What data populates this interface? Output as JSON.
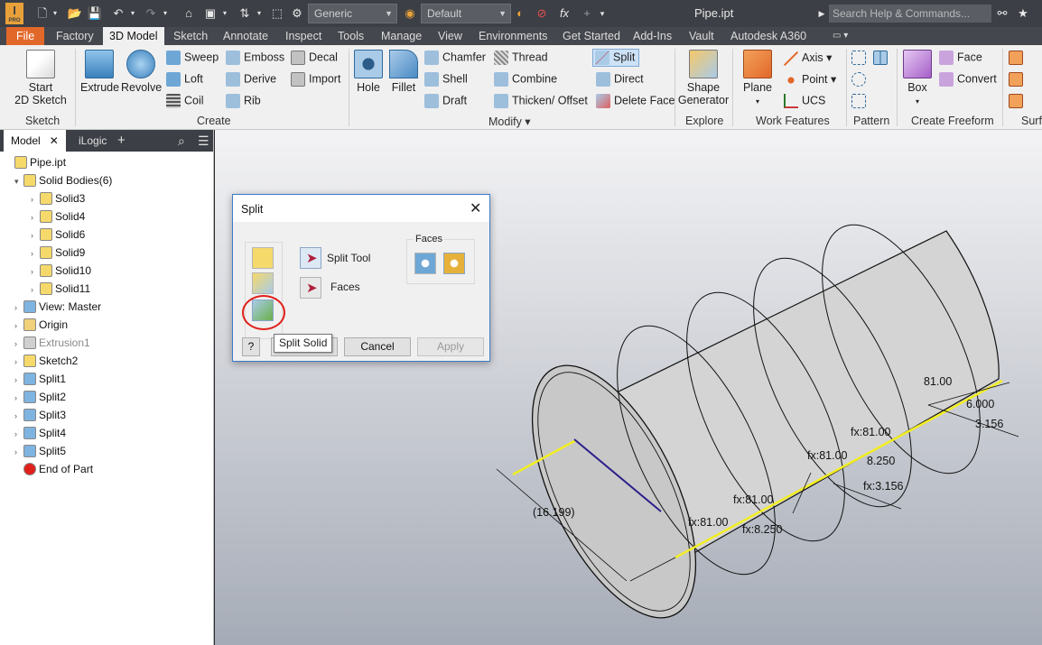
{
  "titlebar": {
    "app_logo": "I",
    "app_logo_sub": "PRO",
    "material_combo": "Generic",
    "appearance_combo": "Default",
    "doc_title": "Pipe.ipt",
    "help_search_placeholder": "Search Help & Commands...",
    "fx_label": "fx"
  },
  "tabs": [
    "File",
    "Factory",
    "3D Model",
    "Sketch",
    "Annotate",
    "Inspect",
    "Tools",
    "Manage",
    "View",
    "Environments",
    "Get Started",
    "Add-Ins",
    "Vault",
    "Autodesk A360"
  ],
  "active_tab": "3D Model",
  "ribbon": {
    "sketch": {
      "start_2d_sketch": "Start\n2D Sketch",
      "start_line1": "Start",
      "start_line2": "2D Sketch",
      "panel": "Sketch"
    },
    "create": {
      "extrude": "Extrude",
      "revolve": "Revolve",
      "sweep": "Sweep",
      "loft": "Loft",
      "coil": "Coil",
      "emboss": "Emboss",
      "derive": "Derive",
      "rib": "Rib",
      "decal": "Decal",
      "import": "Import",
      "panel": "Create"
    },
    "modify": {
      "hole": "Hole",
      "fillet": "Fillet",
      "chamfer": "Chamfer",
      "shell": "Shell",
      "draft": "Draft",
      "thread": "Thread",
      "combine": "Combine",
      "thicken_offset": "Thicken/ Offset",
      "split": "Split",
      "direct": "Direct",
      "delete_face": "Delete Face",
      "panel": "Modify"
    },
    "explore": {
      "shape_generator_line1": "Shape",
      "shape_generator_line2": "Generator",
      "panel": "Explore"
    },
    "work_features": {
      "plane": "Plane",
      "axis": "Axis",
      "point": "Point",
      "ucs": "UCS",
      "panel": "Work Features"
    },
    "pattern": {
      "panel": "Pattern"
    },
    "freeform": {
      "box": "Box",
      "face": "Face",
      "convert": "Convert",
      "panel": "Create Freeform"
    },
    "surface": {
      "panel": "Surf"
    }
  },
  "browser": {
    "tabs": [
      "Model",
      "iLogic"
    ],
    "tree": [
      {
        "label": "Pipe.ipt",
        "indent": 0
      },
      {
        "label": "Solid Bodies(6)",
        "indent": 1
      },
      {
        "label": "Solid3",
        "indent": 2
      },
      {
        "label": "Solid4",
        "indent": 2
      },
      {
        "label": "Solid6",
        "indent": 2
      },
      {
        "label": "Solid9",
        "indent": 2
      },
      {
        "label": "Solid10",
        "indent": 2
      },
      {
        "label": "Solid11",
        "indent": 2
      },
      {
        "label": "View: Master",
        "indent": 1
      },
      {
        "label": "Origin",
        "indent": 1
      },
      {
        "label": "Extrusion1",
        "indent": 1
      },
      {
        "label": "Sketch2",
        "indent": 1
      },
      {
        "label": "Split1",
        "indent": 1
      },
      {
        "label": "Split2",
        "indent": 1
      },
      {
        "label": "Split3",
        "indent": 1
      },
      {
        "label": "Split4",
        "indent": 1
      },
      {
        "label": "Split5",
        "indent": 1
      },
      {
        "label": "End of Part",
        "indent": 1
      }
    ]
  },
  "dialog": {
    "title": "Split",
    "split_tool_label": "Split Tool",
    "faces_label": "Faces",
    "faces_group_label": "Faces",
    "tooltip": "Split Solid",
    "cancel": "Cancel",
    "apply": "Apply"
  },
  "dimensions": {
    "d1": "(16.199)",
    "d2": "fx:81.00",
    "d3": "fx:8.250",
    "d4": "fx:81.00",
    "d5": "fx:81.00",
    "d6": "8.250",
    "d7": "fx:3.156",
    "d8": "fx:81.00",
    "d9": "81.00",
    "d10": "6.000",
    "d11": "3.156"
  },
  "colors": {
    "accent_file_tab": "#e2682a",
    "titlebar": "#3c3f45",
    "dialog_border": "#3d7cc9",
    "highlight_circle": "#e0211b",
    "edge_highlight": "#f2ee22"
  }
}
